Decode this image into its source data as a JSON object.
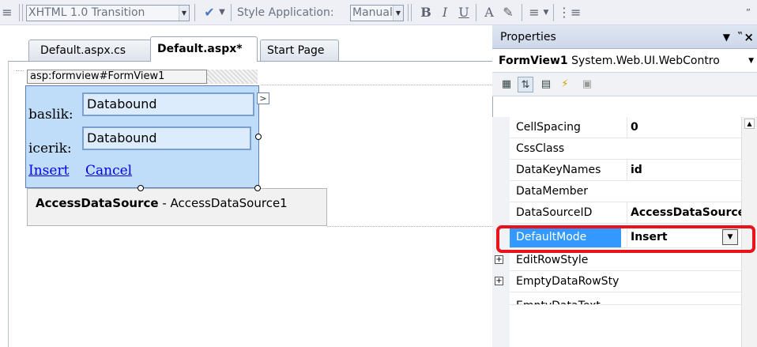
{
  "toolbar": {
    "doctype_value": "XHTML 1.0 Transition",
    "style_app_label": "Style Application:",
    "style_app_value": "Manual",
    "bold_icon": "B",
    "italic_icon": "I",
    "underline_icon": "U"
  },
  "tabs": [
    {
      "label": "Default.aspx.cs"
    },
    {
      "label": "Default.aspx*"
    },
    {
      "label": "Start Page"
    }
  ],
  "design": {
    "formview_tag": "asp:formview#FormView1",
    "fields": [
      {
        "label": "baslik:",
        "value": "Databound"
      },
      {
        "label": "icerik:",
        "value": "Databound"
      }
    ],
    "insert_link": "Insert",
    "cancel_link": "Cancel",
    "smart_tag": ">",
    "datasource_type": "AccessDataSource",
    "datasource_sep": " - ",
    "datasource_name": "AccessDataSource1"
  },
  "properties": {
    "title": "Properties",
    "pin": "↓ ↑ ×",
    "object_name": "FormView1",
    "object_type": "System.Web.UI.WebContro",
    "rows": [
      {
        "name": "CellSpacing",
        "value": "0"
      },
      {
        "name": "CssClass",
        "value": ""
      },
      {
        "name": "DataKeyNames",
        "value": "id"
      },
      {
        "name": "DataMember",
        "value": ""
      },
      {
        "name": "DataSourceID",
        "value": "AccessDataSource"
      },
      {
        "name": "DefaultMode",
        "value": "Insert"
      },
      {
        "name": "EditRowStyle",
        "value": ""
      },
      {
        "name": "EmptyDataRowSty",
        "value": ""
      },
      {
        "name": "EmptyDataText",
        "value": ""
      }
    ]
  },
  "colors": {
    "selection": "#3399ff",
    "highlight": "#e8131b",
    "formview_bg": "#bfdcf9"
  }
}
